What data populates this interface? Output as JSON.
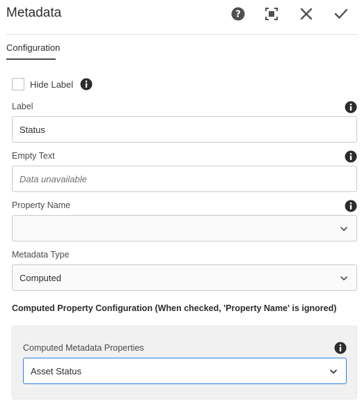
{
  "dialog": {
    "title": "Metadata",
    "actions": {
      "help": "help-icon",
      "fullscreen": "fullscreen-icon",
      "cancel": "close-icon",
      "done": "checkmark-icon"
    }
  },
  "tabs": [
    {
      "label": "Configuration",
      "active": true
    }
  ],
  "form": {
    "hide_label": {
      "label": "Hide Label",
      "checked": false
    },
    "label": {
      "label": "Label",
      "value": "Status"
    },
    "empty_text": {
      "label": "Empty Text",
      "placeholder": "Data unavailable"
    },
    "property_name": {
      "label": "Property Name",
      "value": ""
    },
    "metadata_type": {
      "label": "Metadata Type",
      "value": "Computed"
    },
    "computed_section": {
      "heading": "Computed Property Configuration (When checked, 'Property Name' is ignored)",
      "properties": {
        "label": "Computed Metadata Properties",
        "value": "Asset Status"
      }
    }
  },
  "colors": {
    "accent": "#2680eb",
    "panel_bg": "#f1f1f1",
    "text": "#2c2c2c"
  }
}
